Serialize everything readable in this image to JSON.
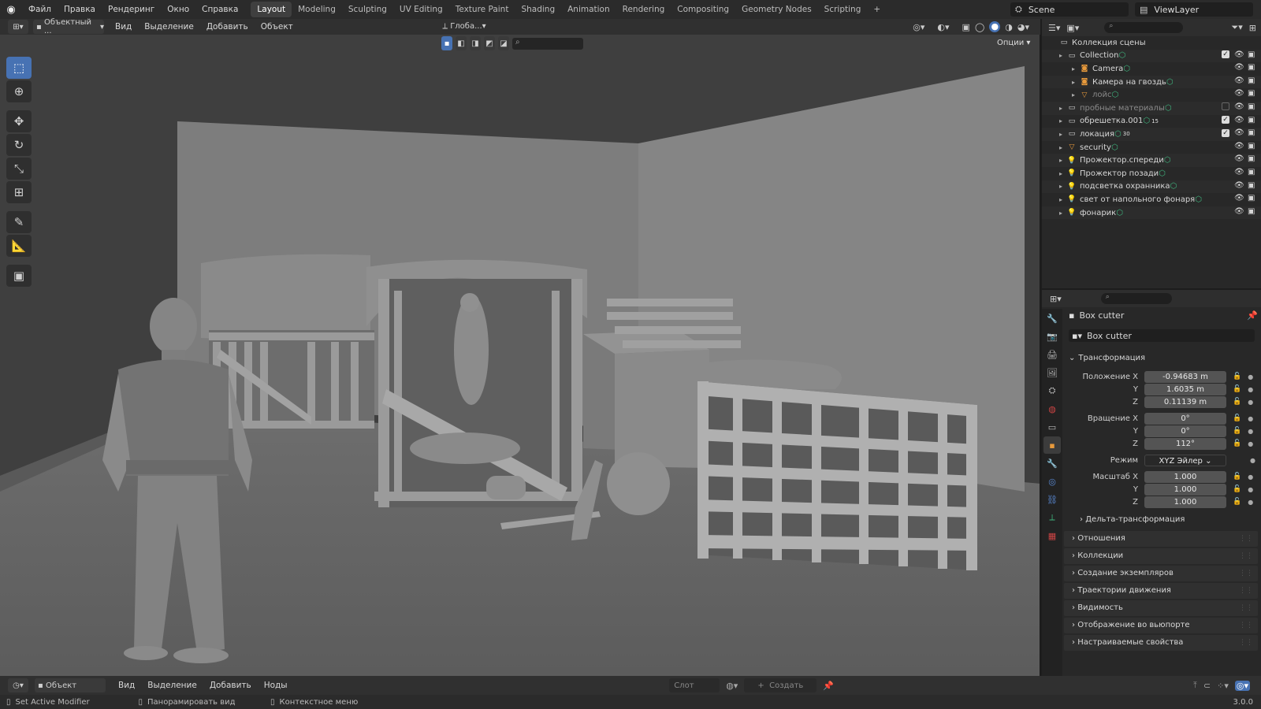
{
  "topbar": {
    "menus": [
      "Файл",
      "Правка",
      "Рендеринг",
      "Окно",
      "Справка"
    ],
    "workspaces": [
      "Layout",
      "Modeling",
      "Sculpting",
      "UV Editing",
      "Texture Paint",
      "Shading",
      "Animation",
      "Rendering",
      "Compositing",
      "Geometry Nodes",
      "Scripting"
    ],
    "add_tab": "+",
    "scene": "Scene",
    "view_layer": "ViewLayer"
  },
  "viewport_header": {
    "mode": "Объектный ...",
    "menus": [
      "Вид",
      "Выделение",
      "Добавить",
      "Объект"
    ],
    "transform_orientation": "Глоба...",
    "options": "Опции"
  },
  "outliner": {
    "root": "Коллекция сцены",
    "rows": [
      {
        "name": "Collection",
        "icon": "collection-icon",
        "indent": 1
      },
      {
        "name": "Camera",
        "icon": "camera-icon",
        "indent": 2
      },
      {
        "name": "Камера на гвоздь",
        "icon": "camera-icon",
        "indent": 2
      },
      {
        "name": "лойс",
        "icon": "mesh-icon",
        "indent": 2,
        "dim": true
      },
      {
        "name": "пробные материалы",
        "icon": "collection-icon",
        "indent": 1,
        "dim": true
      },
      {
        "name": "обрешетка.001",
        "icon": "collection-icon",
        "indent": 1,
        "badge": "15"
      },
      {
        "name": "локация",
        "icon": "collection-icon",
        "indent": 1,
        "badge": "30"
      },
      {
        "name": "security",
        "icon": "mesh-icon",
        "indent": 1
      },
      {
        "name": "Прожектор.спереди",
        "icon": "light-icon",
        "indent": 1
      },
      {
        "name": "Прожектор позади",
        "icon": "light-icon",
        "indent": 1
      },
      {
        "name": "подсветка охранника",
        "icon": "light-icon",
        "indent": 1
      },
      {
        "name": "свет от напольного фонаря",
        "icon": "light-icon",
        "indent": 1
      },
      {
        "name": "фонарик",
        "icon": "light-icon",
        "indent": 1
      }
    ]
  },
  "properties": {
    "object_name": "Box cutter",
    "data_name": "Box cutter",
    "transform_title": "Трансформация",
    "location_label": "Положение X",
    "location": [
      "-0.94683 m",
      "1.6035 m",
      "0.11139 m"
    ],
    "rotation_label": "Вращение X",
    "rotation": [
      "0°",
      "0°",
      "112°"
    ],
    "mode_label": "Режим",
    "mode_value": "XYZ Эйлер",
    "scale_label": "Масштаб X",
    "scale": [
      "1.000",
      "1.000",
      "1.000"
    ],
    "axis_y": "Y",
    "axis_z": "Z",
    "delta": "Дельта-трансформация",
    "panels": [
      "Отношения",
      "Коллекции",
      "Создание экземпляров",
      "Траектории движения",
      "Видимость",
      "Отображение во вьюпорте",
      "Настраиваемые свойства"
    ]
  },
  "bottombar": {
    "editor_mode": "Объект",
    "menus": [
      "Вид",
      "Выделение",
      "Добавить",
      "Ноды"
    ],
    "slot": "Слот",
    "create": "Создать"
  },
  "statusbar": {
    "left": "Set Active Modifier",
    "middle": "Панорамировать вид",
    "right": "Контекстное меню",
    "version": "3.0.0"
  },
  "colors": {
    "accent": "#4772b3",
    "light": "#e89a3c",
    "green": "#3fb57e"
  }
}
